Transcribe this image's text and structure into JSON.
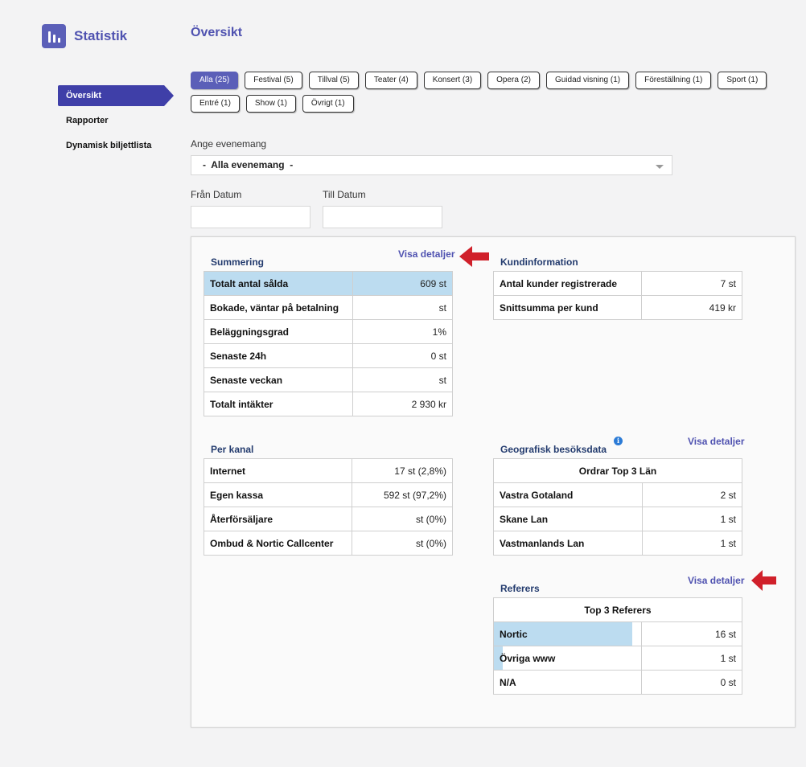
{
  "app": {
    "title": "Statistik"
  },
  "page": {
    "title": "Översikt"
  },
  "sidebar": {
    "items": [
      {
        "label": "Översikt",
        "active": true
      },
      {
        "label": "Rapporter",
        "active": false
      },
      {
        "label": "Dynamisk biljettlista",
        "active": false
      }
    ]
  },
  "filters": {
    "chips": [
      "Alla (25)",
      "Festival (5)",
      "Tillval (5)",
      "Teater (4)",
      "Konsert (3)",
      "Opera (2)",
      "Guidad visning (1)",
      "Föreställning (1)",
      "Sport (1)",
      "Entré (1)",
      "Show (1)",
      "Övrigt (1)"
    ],
    "active_index": 0
  },
  "event": {
    "label": "Ange evenemang",
    "selected": "-  Alla evenemang  -"
  },
  "dates": {
    "from_label": "Från Datum",
    "to_label": "Till Datum",
    "from_value": "",
    "to_value": ""
  },
  "summering": {
    "title": "Summering",
    "link": "Visa detaljer",
    "rows": [
      {
        "k": "Totalt antal sålda",
        "v": "609 st"
      },
      {
        "k": "Bokade, väntar på betalning",
        "v": "st"
      },
      {
        "k": "Beläggningsgrad",
        "v": "1%"
      },
      {
        "k": "Senaste 24h",
        "v": "0 st"
      },
      {
        "k": "Senaste veckan",
        "v": "st"
      },
      {
        "k": "Totalt intäkter",
        "v": "2 930 kr"
      }
    ]
  },
  "kundinfo": {
    "title": "Kundinformation",
    "rows": [
      {
        "k": "Antal kunder registrerade",
        "v": "7 st"
      },
      {
        "k": "Snittsumma per kund",
        "v": "419 kr"
      }
    ]
  },
  "per_kanal": {
    "title": "Per kanal",
    "rows": [
      {
        "k": "Internet",
        "v": "17 st (2,8%)"
      },
      {
        "k": "Egen kassa",
        "v": "592 st (97,2%)"
      },
      {
        "k": "Återförsäljare",
        "v": "st (0%)"
      },
      {
        "k": "Ombud & Nortic Callcenter",
        "v": "st (0%)"
      }
    ]
  },
  "geo": {
    "title": "Geografisk besöksdata",
    "link": "Visa detaljer",
    "header": "Ordrar Top 3 Län",
    "rows": [
      {
        "k": "Vastra Gotaland",
        "v": "2 st"
      },
      {
        "k": "Skane Lan",
        "v": "1 st"
      },
      {
        "k": "Vastmanlands Lan",
        "v": "1 st"
      }
    ]
  },
  "referers": {
    "title": "Referers",
    "link": "Visa detaljer",
    "header": "Top 3 Referers",
    "rows": [
      {
        "k": "Nortic",
        "v": "16 st",
        "share": 0.94
      },
      {
        "k": "Övriga www",
        "v": "1 st",
        "share": 0.06
      },
      {
        "k": "N/A",
        "v": "0 st",
        "share": 0
      }
    ]
  },
  "colors": {
    "accent": "#4f52b0",
    "nav_active": "#3f3fa8",
    "highlight": "#bcdcf0",
    "arrow": "#d0202a"
  }
}
